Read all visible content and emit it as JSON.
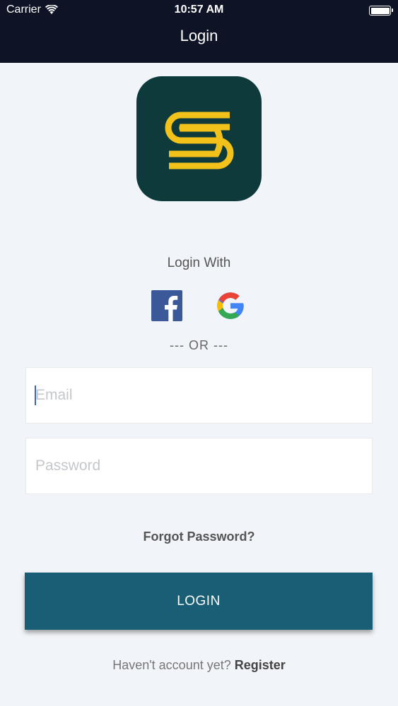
{
  "status_bar": {
    "carrier": "Carrier",
    "time": "10:57 AM",
    "battery_level": 1.0
  },
  "nav": {
    "title": "Login"
  },
  "logo": {
    "icon": "s-brand-logo",
    "background": "#0e3a3c",
    "accent": "#f2c21b"
  },
  "social": {
    "heading": "Login With",
    "providers": [
      {
        "name": "facebook",
        "icon": "facebook-icon"
      },
      {
        "name": "google",
        "icon": "google-icon"
      }
    ],
    "separator": "--- OR ---"
  },
  "form": {
    "email": {
      "value": "",
      "placeholder": "Email"
    },
    "password": {
      "value": "",
      "placeholder": "Password"
    },
    "forgot_label": "Forgot Password?",
    "login_label": "LOGIN"
  },
  "footer": {
    "prompt": "Haven't account yet?",
    "register_label": "Register"
  },
  "colors": {
    "topbar": "#0e1426",
    "primary_button": "#195e74",
    "background": "#f1f4f8"
  }
}
